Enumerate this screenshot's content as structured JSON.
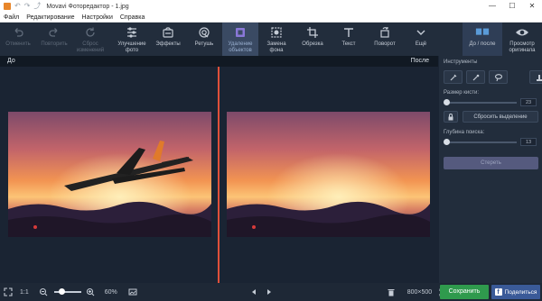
{
  "window": {
    "title": "Movavi Фоторедактор - 1.jpg",
    "minimize": "—",
    "maximize": "☐",
    "close": "✕"
  },
  "quick_access": [
    "↶",
    "↷",
    "⤴"
  ],
  "menu": [
    "Файл",
    "Редактирование",
    "Настройки",
    "Справка"
  ],
  "toolbar": {
    "undo": "Отменить",
    "redo": "Повторить",
    "reset": "Сброс\nизменений",
    "enhance": "Улучшение\nфото",
    "effects": "Эффекты",
    "retouch": "Ретушь",
    "remove_objects": "Удаление\nобъектов",
    "replace_bg": "Замена\nфона",
    "crop": "Обрезка",
    "text": "Текст",
    "rotate": "Поворот",
    "more": "Ещё",
    "before_after": "До / после",
    "view_original": "Просмотр\nоригинала"
  },
  "canvas": {
    "before_label": "До",
    "after_label": "После"
  },
  "panel": {
    "tools_label": "Инструменты",
    "brush_size_label": "Размер кисти:",
    "brush_size_value": "23",
    "brush_size_fraction": 0.03,
    "reset_selection": "Сбросить выделение",
    "search_depth_label": "Глубина поиска:",
    "search_depth_value": "13",
    "search_depth_fraction": 0.03,
    "delete_button": "Стереть"
  },
  "status": {
    "ratio": "1:1",
    "zoom": "60%",
    "zoom_fraction": 0.3,
    "dimensions": "800×500",
    "save": "Сохранить",
    "share": "Поделиться"
  },
  "colors": {
    "accent_divider": "#e0503a",
    "save_green": "#2f9a4d",
    "facebook_blue": "#3a5a98"
  }
}
